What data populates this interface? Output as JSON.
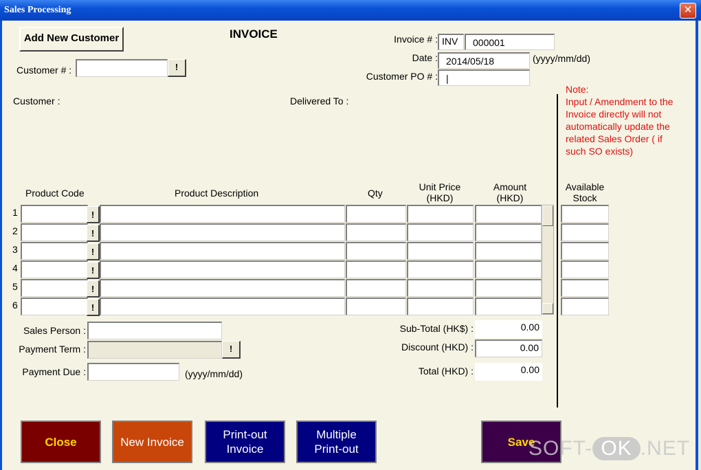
{
  "window": {
    "title": "Sales Processing",
    "close_glyph": "✕"
  },
  "header": {
    "add_customer_label": "Add New Customer",
    "invoice_heading": "INVOICE",
    "customer_no_label": "Customer # :",
    "customer_no_value": "",
    "lookup_glyph": "!",
    "invoice_no_label": "Invoice # :",
    "invoice_prefix": "INV",
    "invoice_no_value": "000001",
    "date_label": "Date :",
    "date_value": "2014/05/18",
    "date_format": "(yyyy/mm/dd)",
    "customer_po_label": "Customer PO # :",
    "customer_po_value": "|",
    "customer_label": "Customer :",
    "delivered_to_label": "Delivered To :"
  },
  "note": {
    "title": "Note:",
    "lines": [
      "Input / Amendment to the",
      "Invoice directly will not",
      "automatically update the",
      "related Sales Order ( if",
      "such SO exists)"
    ]
  },
  "table": {
    "columns": {
      "product_code": "Product Code",
      "product_description": "Product Description",
      "qty": "Qty",
      "unit_price_1": "Unit Price",
      "unit_price_2": "(HKD)",
      "amount_1": "Amount",
      "amount_2": "(HKD)",
      "available_1": "Available",
      "available_2": "Stock"
    },
    "rows": [
      "1",
      "2",
      "3",
      "4",
      "5",
      "6"
    ]
  },
  "footer": {
    "sales_person_label": "Sales Person :",
    "sales_person_value": "",
    "payment_term_label": "Payment Term :",
    "payment_term_value": "",
    "payment_due_label": "Payment Due :",
    "payment_due_value": "",
    "payment_due_format": "(yyyy/mm/dd)",
    "subtotal_label": "Sub-Total (HK$) :",
    "subtotal_value": "0.00",
    "discount_label": "Discount (HKD) :",
    "discount_value": "0.00",
    "total_label": "Total (HKD) :",
    "total_value": "0.00"
  },
  "buttons": {
    "close": "Close",
    "new_invoice": "New Invoice",
    "printout_1": "Print-out",
    "printout_2": "Invoice",
    "multiple_1": "Multiple",
    "multiple_2": "Print-out",
    "save": "Save"
  },
  "watermark": {
    "left": "SOFT-",
    "mid": "OK",
    "right": ".NET"
  },
  "colors": {
    "close": "#7a0000",
    "new_invoice": "#c8460a",
    "print": "#000080",
    "save": "#3c0048",
    "note": "#e01010",
    "titlebar": "#0a52d6"
  }
}
